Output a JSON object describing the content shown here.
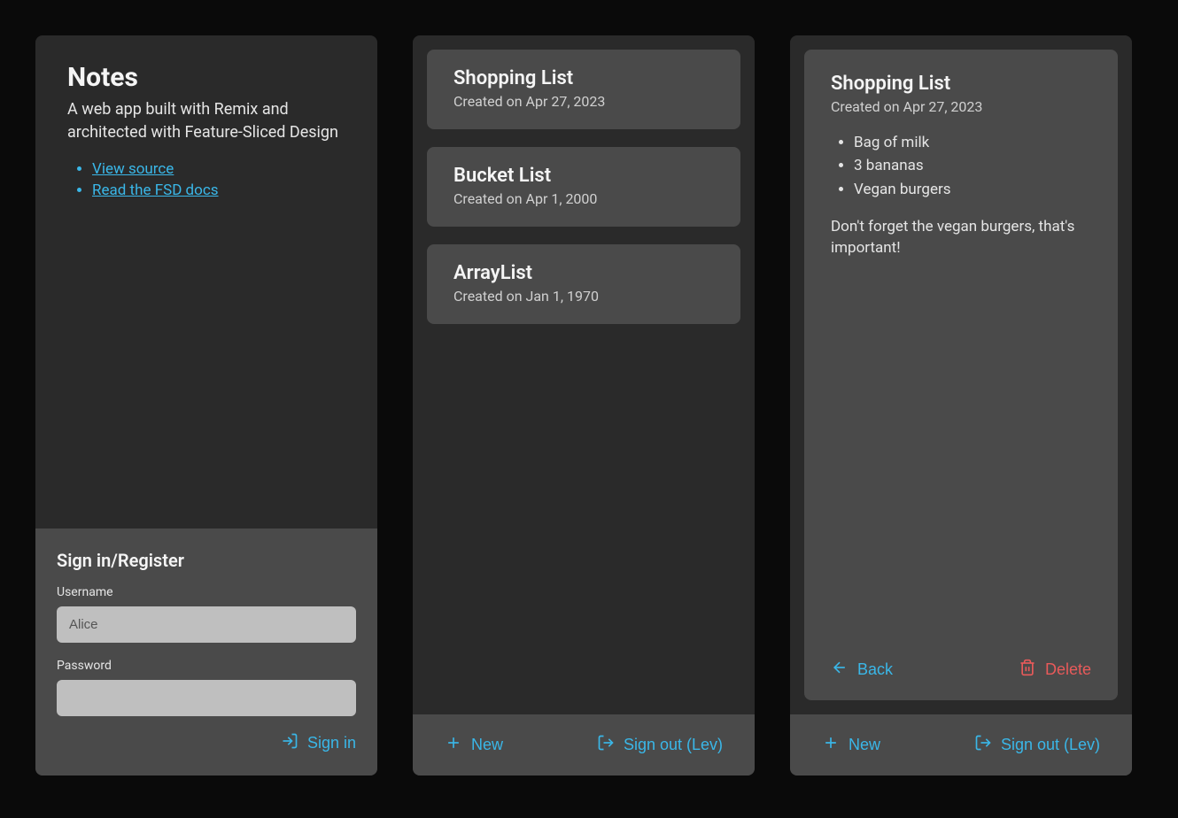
{
  "panel1": {
    "title": "Notes",
    "subtitle": "A web app built with Remix and architected with Feature-Sliced Design",
    "links": [
      {
        "label": "View source"
      },
      {
        "label": "Read the FSD docs"
      }
    ],
    "form": {
      "title": "Sign in/Register",
      "username_label": "Username",
      "username_placeholder": "Alice",
      "password_label": "Password",
      "signin_label": "Sign in"
    }
  },
  "panel2": {
    "notes": [
      {
        "title": "Shopping List",
        "meta": "Created on Apr 27, 2023"
      },
      {
        "title": "Bucket List",
        "meta": "Created on Apr 1, 2000"
      },
      {
        "title": "ArrayList",
        "meta": "Created on Jan 1, 1970"
      }
    ],
    "footer": {
      "new_label": "New",
      "signout_label": "Sign out (Lev)"
    }
  },
  "panel3": {
    "note": {
      "title": "Shopping List",
      "meta": "Created on Apr 27, 2023",
      "items": [
        "Bag of milk",
        "3 bananas",
        "Vegan burgers"
      ],
      "body": "Don't forget the vegan burgers, that's important!"
    },
    "actions": {
      "back_label": "Back",
      "delete_label": "Delete"
    },
    "footer": {
      "new_label": "New",
      "signout_label": "Sign out (Lev)"
    }
  }
}
